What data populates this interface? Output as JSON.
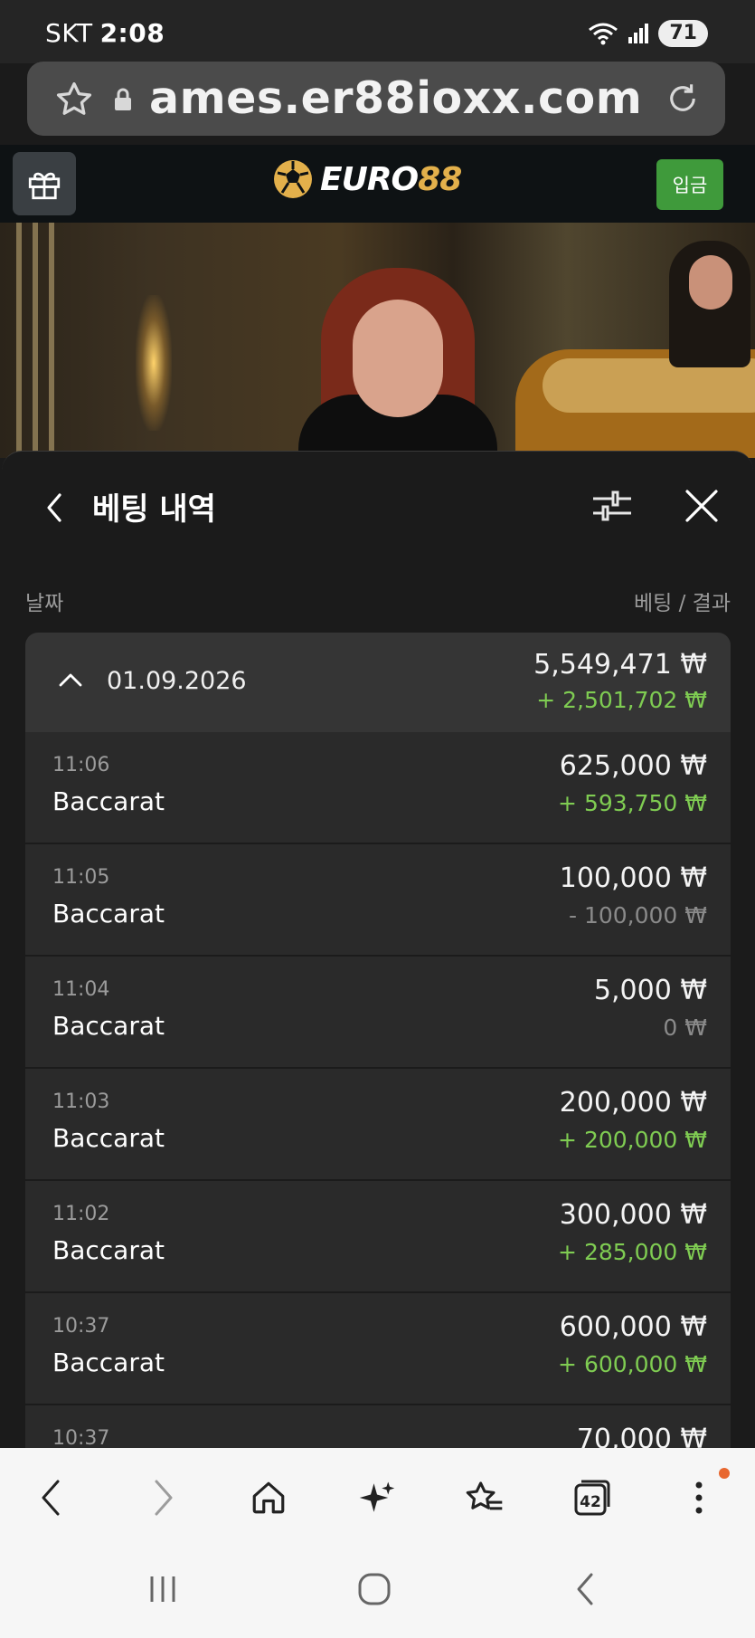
{
  "status_bar": {
    "carrier": "SKT",
    "time": "2:08",
    "battery": "71"
  },
  "browser": {
    "url": "ames.er88ioxx.com",
    "tab_count": "42"
  },
  "site": {
    "logo_part1": "EURO",
    "logo_part2": "88",
    "deposit_label": "입금"
  },
  "panel": {
    "title": "베팅 내역",
    "col_date": "날짜",
    "col_bet_result": "베팅 / 결과"
  },
  "date_group": {
    "date": "01.09.2026",
    "total_bet": "5,549,471 ₩",
    "net_result": "+ 2,501,702 ₩"
  },
  "bets": [
    {
      "time": "11:06",
      "game": "Baccarat",
      "amount": "625,000 ₩",
      "result": "+ 593,750 ₩",
      "result_type": "win"
    },
    {
      "time": "11:05",
      "game": "Baccarat",
      "amount": "100,000 ₩",
      "result": "- 100,000 ₩",
      "result_type": "lose"
    },
    {
      "time": "11:04",
      "game": "Baccarat",
      "amount": "5,000 ₩",
      "result": "0 ₩",
      "result_type": "zero"
    },
    {
      "time": "11:03",
      "game": "Baccarat",
      "amount": "200,000 ₩",
      "result": "+ 200,000 ₩",
      "result_type": "win"
    },
    {
      "time": "11:02",
      "game": "Baccarat",
      "amount": "300,000 ₩",
      "result": "+ 285,000 ₩",
      "result_type": "win"
    },
    {
      "time": "10:37",
      "game": "Baccarat",
      "amount": "600,000 ₩",
      "result": "+ 600,000 ₩",
      "result_type": "win"
    },
    {
      "time": "10:37",
      "game": "",
      "amount": "70,000 ₩",
      "result": "",
      "result_type": "zero"
    }
  ],
  "colors": {
    "win": "#7fcc52",
    "lose": "#8a8a8a",
    "deposit_button": "#3f9a3b",
    "logo_gold": "#e3b04b",
    "notification_dot": "#e8672f"
  },
  "icons": [
    "star-icon",
    "lock-icon",
    "reload-icon",
    "gift-icon",
    "soccer-ball-icon",
    "back-chevron-icon",
    "filter-icon",
    "close-icon",
    "chevron-up-icon",
    "nav-back-icon",
    "nav-forward-icon",
    "home-icon",
    "sparkle-icon",
    "bookmark-star-icon",
    "tabs-icon",
    "more-icon",
    "recent-apps-icon",
    "home-circle-icon",
    "system-back-icon"
  ]
}
